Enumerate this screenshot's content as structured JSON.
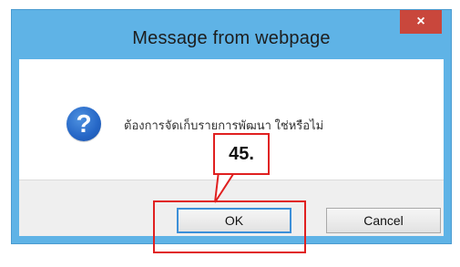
{
  "dialog": {
    "title": "Message from webpage",
    "close_glyph": "×",
    "message": "ต้องการจัดเก็บรายการพัฒนา ใช่หรือไม่",
    "icon": "question-icon",
    "icon_glyph": "?",
    "buttons": {
      "ok_label": "OK",
      "cancel_label": "Cancel"
    }
  },
  "annotation": {
    "step_label": "45.",
    "color": "#e02020"
  },
  "colors": {
    "frame": "#5fb3e6",
    "close_button": "#c9473c",
    "button_bar": "#efefef"
  }
}
